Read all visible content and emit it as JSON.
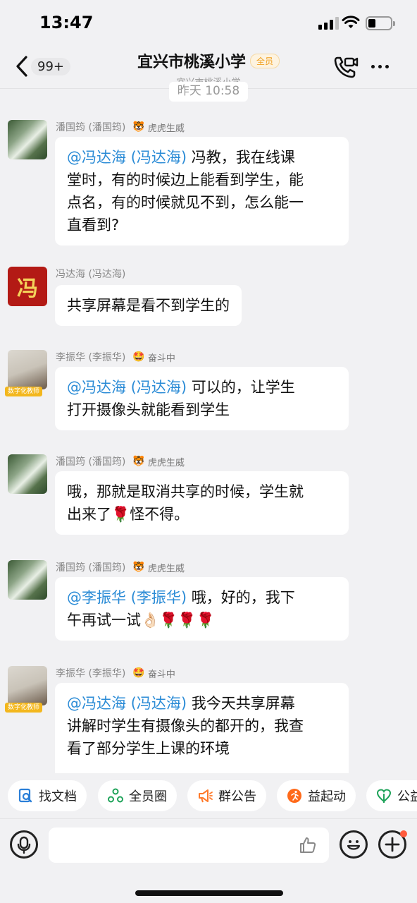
{
  "status": {
    "time": "13:47"
  },
  "header": {
    "back_badge": "99+",
    "title": "宜兴市桃溪小学",
    "members_badge": "全员",
    "subtitle": "宜兴市桃溪小学"
  },
  "timestamp": "昨天 10:58",
  "messages": [
    {
      "sender": "潘国筠 (潘国筠)",
      "badge_emoji": "🐯",
      "badge": "虎虎生威",
      "mention": "@冯达海 (冯达海)",
      "text_lines": [
        "冯教，我在线课",
        "堂时，有的时候边上能看到学生，能",
        "点名，有的时候就见不到，怎么能一",
        "直看到?"
      ]
    },
    {
      "sender": "冯达海 (冯达海)",
      "avatar_char": "冯",
      "text_lines": [
        "共享屏幕是看不到学生的"
      ]
    },
    {
      "sender": "李振华 (李振华)",
      "badge_emoji": "🤩",
      "badge": "奋斗中",
      "avatar_tag": "数字化教师",
      "mention": "@冯达海 (冯达海)",
      "text_lines": [
        "可以的，让学生",
        "打开摄像头就能看到学生"
      ]
    },
    {
      "sender": "潘国筠 (潘国筠)",
      "badge_emoji": "🐯",
      "badge": "虎虎生威",
      "text_lines": [
        "哦，那就是取消共享的时候，学生就",
        "出来了🌹怪不得。"
      ]
    },
    {
      "sender": "潘国筠 (潘国筠)",
      "badge_emoji": "🐯",
      "badge": "虎虎生威",
      "mention": "@李振华 (李振华)",
      "text_lines": [
        "哦，好的，我下",
        "午再试一试👌🏻🌹🌹🌹"
      ]
    },
    {
      "sender": "李振华 (李振华)",
      "badge_emoji": "🤩",
      "badge": "奋斗中",
      "avatar_tag": "数字化教师",
      "mention": "@冯达海 (冯达海)",
      "text_lines": [
        "我今天共享屏幕",
        "讲解时学生有摄像头的都开的，我查",
        "看了部分学生上课的环境"
      ]
    }
  ],
  "quickbar": [
    {
      "label": "找文档",
      "icon": "doc-search-icon",
      "color": "#2a7fd8"
    },
    {
      "label": "全员圈",
      "icon": "circle-group-icon",
      "color": "#1fa35a"
    },
    {
      "label": "群公告",
      "icon": "megaphone-icon",
      "color": "#ff7a2a"
    },
    {
      "label": "益起动",
      "icon": "runner-icon",
      "color": "#ff6a1a"
    },
    {
      "label": "公益",
      "icon": "charity-icon",
      "color": "#1fa35a"
    }
  ],
  "input": {
    "placeholder": ""
  }
}
